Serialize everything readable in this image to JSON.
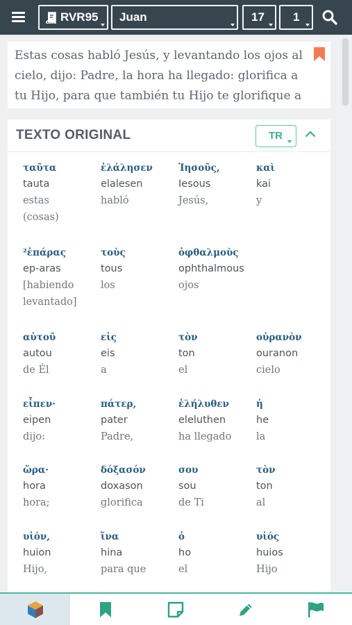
{
  "header": {
    "menu_icon": "hamburger-menu-icon",
    "version": "RVR95",
    "version_icon": "book-icon",
    "book": "Juan",
    "chapter": "17",
    "verse": "1",
    "search_icon": "search-icon"
  },
  "verse_card": {
    "text": "Estas cosas habló Jesús, y levantando los ojos al cielo, dijo: Padre, la hora ha llegado: glorifica a tu Hijo, para que también tu Hijo te glorifique a ti,",
    "bookmark_icon": "bookmark-icon",
    "bookmark_color": "#f47c55"
  },
  "original_text": {
    "title": "TEXTO ORIGINAL",
    "source": "TR",
    "collapse_icon": "chevron-up-icon",
    "accent_color": "#3eae92",
    "rows": [
      [
        {
          "greek": "ταῦτα",
          "translit": "tauta",
          "translation": "estas (cosas)"
        },
        {
          "greek": "ἐλάλησεν",
          "translit": "elalesen",
          "translation": "habló"
        },
        {
          "greek": "Ἰησοῦς,",
          "translit": "Iesous",
          "translation": "Jesús,"
        },
        {
          "greek": "καὶ",
          "translit": "kai",
          "translation": "y"
        }
      ],
      [
        {
          "greek": "²ἐπάρας",
          "translit": "ep-aras",
          "translation": "[habiendo levantado]"
        },
        {
          "greek": "τοὺς",
          "translit": "tous",
          "translation": "los"
        },
        {
          "greek": "ὀφθαλμοὺς",
          "translit": "ophthalmous",
          "translation": "ojos"
        }
      ],
      [
        {
          "greek": "αὐτοῦ",
          "translit": "autou",
          "translation": "de Él"
        },
        {
          "greek": "εἰς",
          "translit": "eis",
          "translation": "a"
        },
        {
          "greek": "τὸν",
          "translit": "ton",
          "translation": "el"
        },
        {
          "greek": "οὐρανὸν",
          "translit": "ouranon",
          "translation": "cielo"
        }
      ],
      [
        {
          "greek": "εἶπεν·",
          "translit": "eipen",
          "translation": "dijo:"
        },
        {
          "greek": "πάτερ,",
          "translit": "pater",
          "translation": "Padre,"
        },
        {
          "greek": "ἐλήλυθεν",
          "translit": "eleluthen",
          "translation": "ha llegado"
        },
        {
          "greek": "ἡ",
          "translit": "he",
          "translation": "la"
        }
      ],
      [
        {
          "greek": "ὥρα·",
          "translit": "hora",
          "translation": "hora;"
        },
        {
          "greek": "δόξασόν",
          "translit": "doxason",
          "translation": "glorifica"
        },
        {
          "greek": "σου",
          "translit": "sou",
          "translation": "de Ti"
        },
        {
          "greek": "τὸν",
          "translit": "ton",
          "translation": "al"
        }
      ],
      [
        {
          "greek": "υἱόν,",
          "translit": "huion",
          "translation": "Hijo,"
        },
        {
          "greek": "ἵνα",
          "translit": "hina",
          "translation": "para que"
        },
        {
          "greek": "ὁ",
          "translit": "ho",
          "translation": "el"
        },
        {
          "greek": "υἱός",
          "translit": "huios",
          "translation": "Hijo"
        }
      ]
    ]
  },
  "bottom_nav": {
    "items": [
      {
        "icon": "cube-icon",
        "active": true
      },
      {
        "icon": "bookmark-icon",
        "active": false
      },
      {
        "icon": "note-icon",
        "active": false
      },
      {
        "icon": "pencil-icon",
        "active": false
      },
      {
        "icon": "flag-icon",
        "active": false
      }
    ],
    "accent_color": "#2fa283"
  }
}
